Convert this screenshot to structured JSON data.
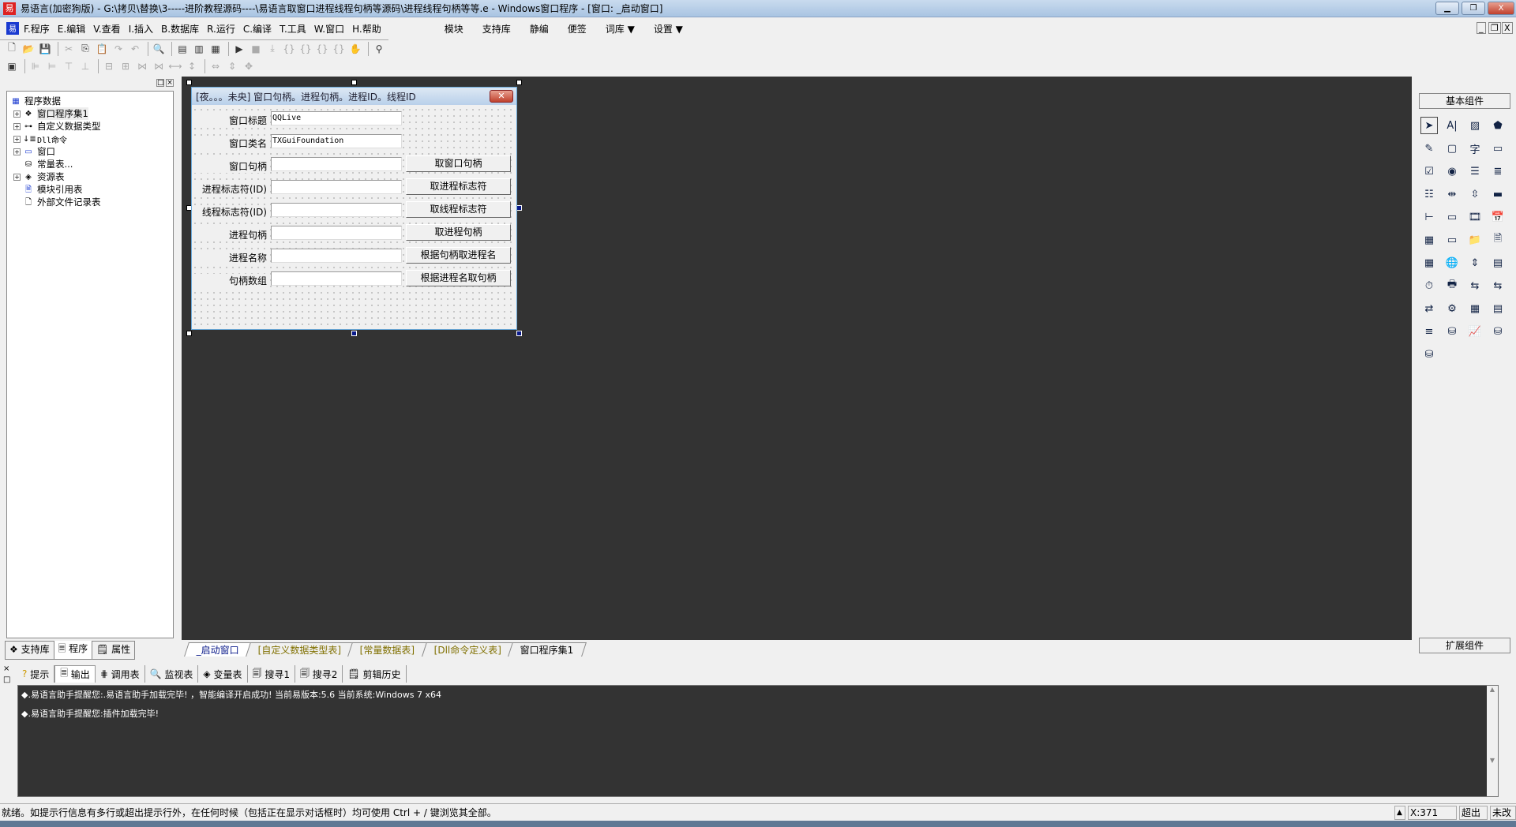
{
  "window": {
    "title": "易语言(加密狗版) - G:\\拷贝\\替换\\3-----进阶教程源码----\\易语言取窗口进程线程句柄等源码\\进程线程句柄等等.e - Windows窗口程序 - [窗口: _启动窗口]",
    "min": "▁",
    "restore": "❐",
    "close": "X"
  },
  "menu": {
    "items": [
      "F.程序",
      "E.编辑",
      "V.查看",
      "I.插入",
      "B.数据库",
      "R.运行",
      "C.编译",
      "T.工具",
      "W.窗口",
      "H.帮助"
    ],
    "right": [
      "模块",
      "支持库",
      "静编",
      "便签",
      "词库 ▼",
      "设置 ▼"
    ],
    "mdi": [
      "_",
      "❐",
      "X"
    ]
  },
  "left": {
    "root": "程序数据",
    "items": [
      "窗口程序集1",
      "自定义数据类型",
      "Dll命令",
      "窗口",
      "常量表...",
      "资源表",
      "模块引用表",
      "外部文件记录表"
    ],
    "tabs": [
      "支持库",
      "程序",
      "属性"
    ]
  },
  "form": {
    "title": "[夜。。。未央] 窗口句柄。进程句柄。进程ID。线程ID",
    "close": "✕",
    "rows": [
      {
        "label": "窗口标题",
        "value": "QQLive",
        "button": ""
      },
      {
        "label": "窗口类名",
        "value": "TXGuiFoundation",
        "button": ""
      },
      {
        "label": "窗口句柄",
        "value": "",
        "button": "取窗口句柄"
      },
      {
        "label": "进程标志符(ID)",
        "value": "",
        "button": "取进程标志符"
      },
      {
        "label": "线程标志符(ID)",
        "value": "",
        "button": "取线程标志符"
      },
      {
        "label": "进程句柄",
        "value": "",
        "button": "取进程句柄"
      },
      {
        "label": "进程名称",
        "value": "",
        "button": "根据句柄取进程名"
      },
      {
        "label": "句柄数组",
        "value": "",
        "button": "根据进程名取句柄"
      }
    ]
  },
  "design_tabs": [
    "_启动窗口",
    "[自定义数据类型表]",
    "[常量数据表]",
    "[Dll命令定义表]",
    "窗口程序集1"
  ],
  "right": {
    "header": "基本组件",
    "footer": "扩展组件"
  },
  "output_tabs": [
    "提示",
    "输出",
    "调用表",
    "监视表",
    "变量表",
    "搜寻1",
    "搜寻2",
    "剪辑历史"
  ],
  "output_lines": [
    "◆.易语言助手提醒您:.易语言助手加载完毕! ，智能编译开启成功!  当前易版本:5.6  当前系统:Windows 7 x64",
    "◆.易语言助手提醒您:插件加载完毕!"
  ],
  "status": {
    "text": "就绪。如提示行信息有多行或超出提示行外，在任何时候（包括正在显示对话框时）均可使用 Ctrl + / 键浏览其全部。",
    "x": "X:371",
    "overwrite": "超出",
    "modified": "未改"
  },
  "colors": {
    "design_bg": "#333333",
    "accent": "#0a1a8a",
    "tab_inactive": "#807000"
  }
}
